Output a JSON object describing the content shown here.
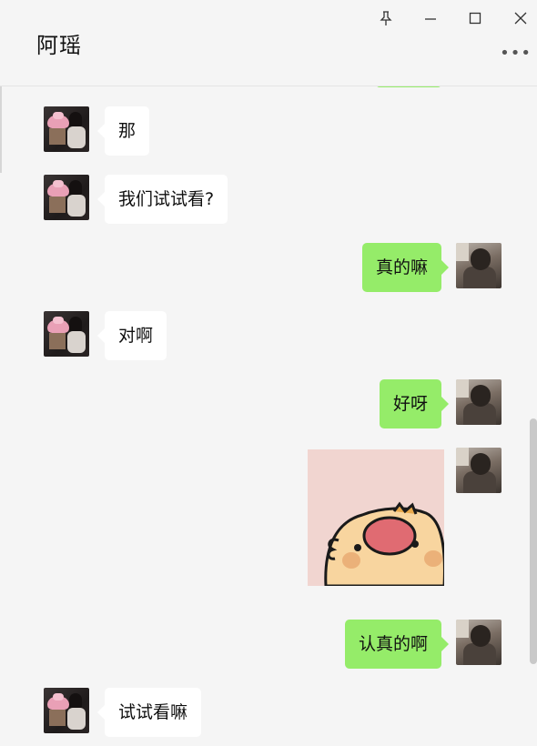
{
  "window": {
    "title": "阿瑶",
    "more_label": "•••"
  },
  "messages": [
    {
      "sender": "her",
      "text": "那"
    },
    {
      "sender": "her",
      "text": "我们试试看?"
    },
    {
      "sender": "me",
      "text": "真的嘛"
    },
    {
      "sender": "her",
      "text": "对啊"
    },
    {
      "sender": "me",
      "text": "好呀"
    },
    {
      "sender": "me",
      "type": "sticker"
    },
    {
      "sender": "me",
      "text": "认真的啊"
    },
    {
      "sender": "her",
      "text": "试试看嘛"
    }
  ],
  "colors": {
    "outgoing_bubble": "#95ec69",
    "incoming_bubble": "#ffffff",
    "background": "#f5f5f5"
  }
}
